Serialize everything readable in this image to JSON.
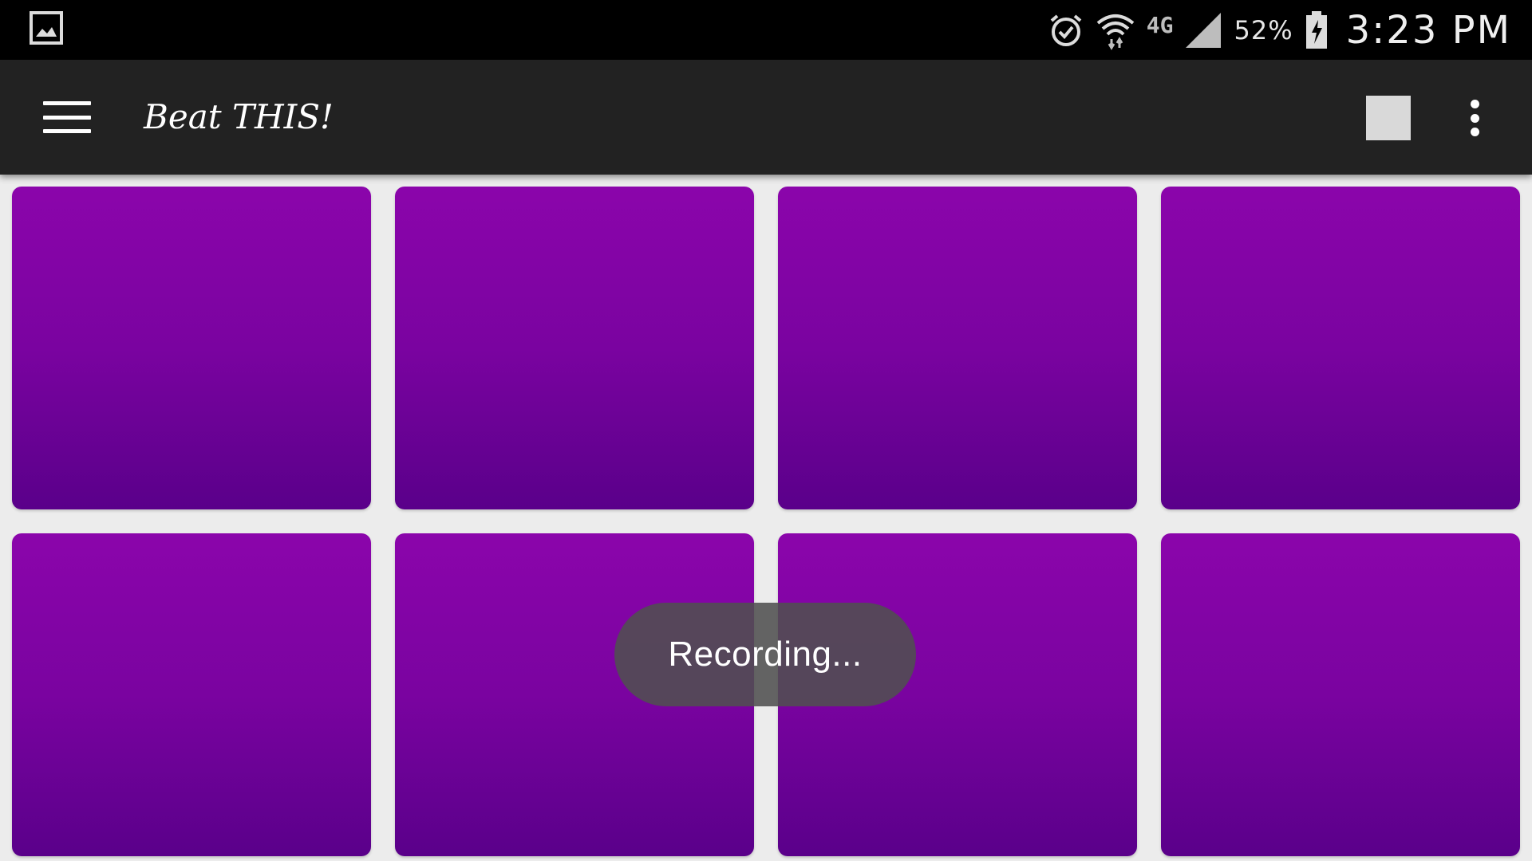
{
  "status_bar": {
    "left_icon": "gallery-icon",
    "icons": [
      "alarm-icon",
      "wifi-icon",
      "cell-signal-icon",
      "battery-charging-icon"
    ],
    "network_label": "4G",
    "battery_percent": "52%",
    "time": "3:23 PM"
  },
  "app_bar": {
    "menu_icon": "hamburger-menu-icon",
    "title": "Beat THIS!",
    "stop_icon": "stop-icon",
    "overflow_icon": "more-vert-icon"
  },
  "pads": {
    "count": 8,
    "color_top": "#8b05ab",
    "color_bottom": "#5a008a"
  },
  "toast": {
    "text": "Recording..."
  },
  "colors": {
    "status_bar_bg": "#000000",
    "app_bar_bg": "#222222",
    "background": "#ececec",
    "toast_bg": "#505050"
  }
}
